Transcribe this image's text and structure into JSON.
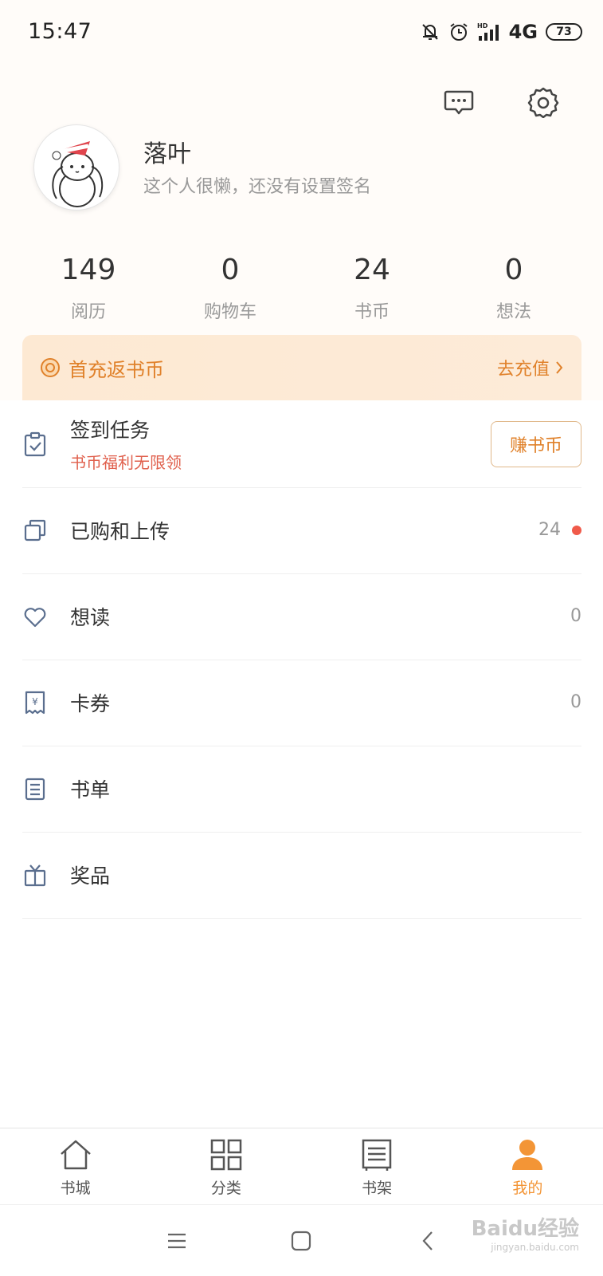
{
  "status_bar": {
    "time": "15:47",
    "network": "4G",
    "battery": "73",
    "icons": [
      "mute-bell-icon",
      "alarm-icon",
      "signal-icon"
    ]
  },
  "header": {
    "icons": [
      "message-icon",
      "gear-icon"
    ]
  },
  "profile": {
    "name": "落叶",
    "signature": "这个人很懒，还没有设置签名"
  },
  "stats": [
    {
      "value": "149",
      "label": "阅历"
    },
    {
      "value": "0",
      "label": "购物车"
    },
    {
      "value": "24",
      "label": "书币"
    },
    {
      "value": "0",
      "label": "想法"
    }
  ],
  "recharge_banner": {
    "text": "首充返书币",
    "link": "去充值"
  },
  "menu": {
    "checkin": {
      "title": "签到任务",
      "subtitle": "书币福利无限领",
      "button": "赚书币"
    },
    "purchased": {
      "title": "已购和上传",
      "count": "24"
    },
    "wishlist": {
      "title": "想读",
      "count": "0"
    },
    "coupons": {
      "title": "卡券",
      "count": "0"
    },
    "booklist": {
      "title": "书单"
    },
    "prizes": {
      "title": "奖品"
    }
  },
  "tabs": [
    {
      "label": "书城",
      "icon": "home-icon"
    },
    {
      "label": "分类",
      "icon": "grid-icon"
    },
    {
      "label": "书架",
      "icon": "bookshelf-icon"
    },
    {
      "label": "我的",
      "icon": "user-icon"
    }
  ],
  "active_tab": "我的",
  "watermark": {
    "text": "Baidu经验",
    "sub": "jingyan.baidu.com"
  },
  "colors": {
    "accent": "#f39536",
    "banner_text": "#e0812a",
    "subtitle_red": "#e0604d",
    "icon_blue": "#5a6e8e"
  }
}
